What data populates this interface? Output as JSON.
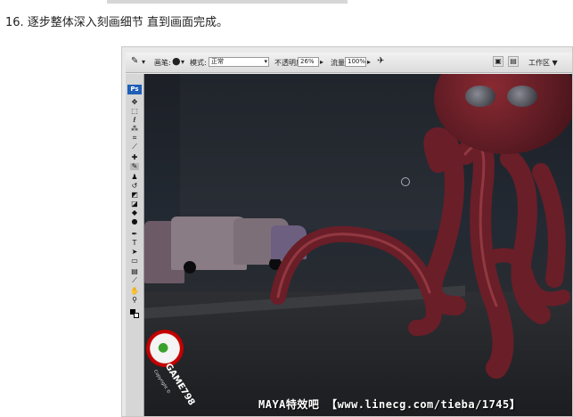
{
  "heading": "16. 逐步整体深入刻画细节 直到画面完成。",
  "options_bar": {
    "brush_label": "画笔:",
    "mode_label": "模式:",
    "mode_value": "正常",
    "opacity_label": "不透明度:",
    "opacity_value": "26%",
    "flow_label": "流量:",
    "flow_value": "100%",
    "workspace_label": "工作区 ▼",
    "icons": [
      "brush-tool-icon",
      "brush-preset-icon",
      "airbrush-icon",
      "bridge-icon",
      "screen-mode-icon"
    ]
  },
  "tools_panel": {
    "logo": "Ps",
    "icons": [
      "move-icon",
      "marquee-icon",
      "lasso-icon",
      "magic-wand-icon",
      "crop-icon",
      "eyedropper-icon",
      "healing-icon",
      "brush-icon",
      "stamp-icon",
      "history-brush-icon",
      "eraser-icon",
      "gradient-icon",
      "blur-icon",
      "dodge-icon",
      "pen-icon",
      "type-icon",
      "path-select-icon",
      "shape-icon",
      "notes-icon",
      "eyedropper2-icon",
      "hand-icon",
      "zoom-icon",
      "color-swatch-icon"
    ]
  },
  "canvas": {
    "logo_text": "GAME798",
    "logo_copyright": "Copyright ©",
    "watermark": "MAYA特效吧 【www.linecg.com/tieba/1745】"
  },
  "colors": {
    "ps_blue": "#1f5fb8",
    "octopus": "#6a1e28",
    "logo_red": "#c40000"
  }
}
